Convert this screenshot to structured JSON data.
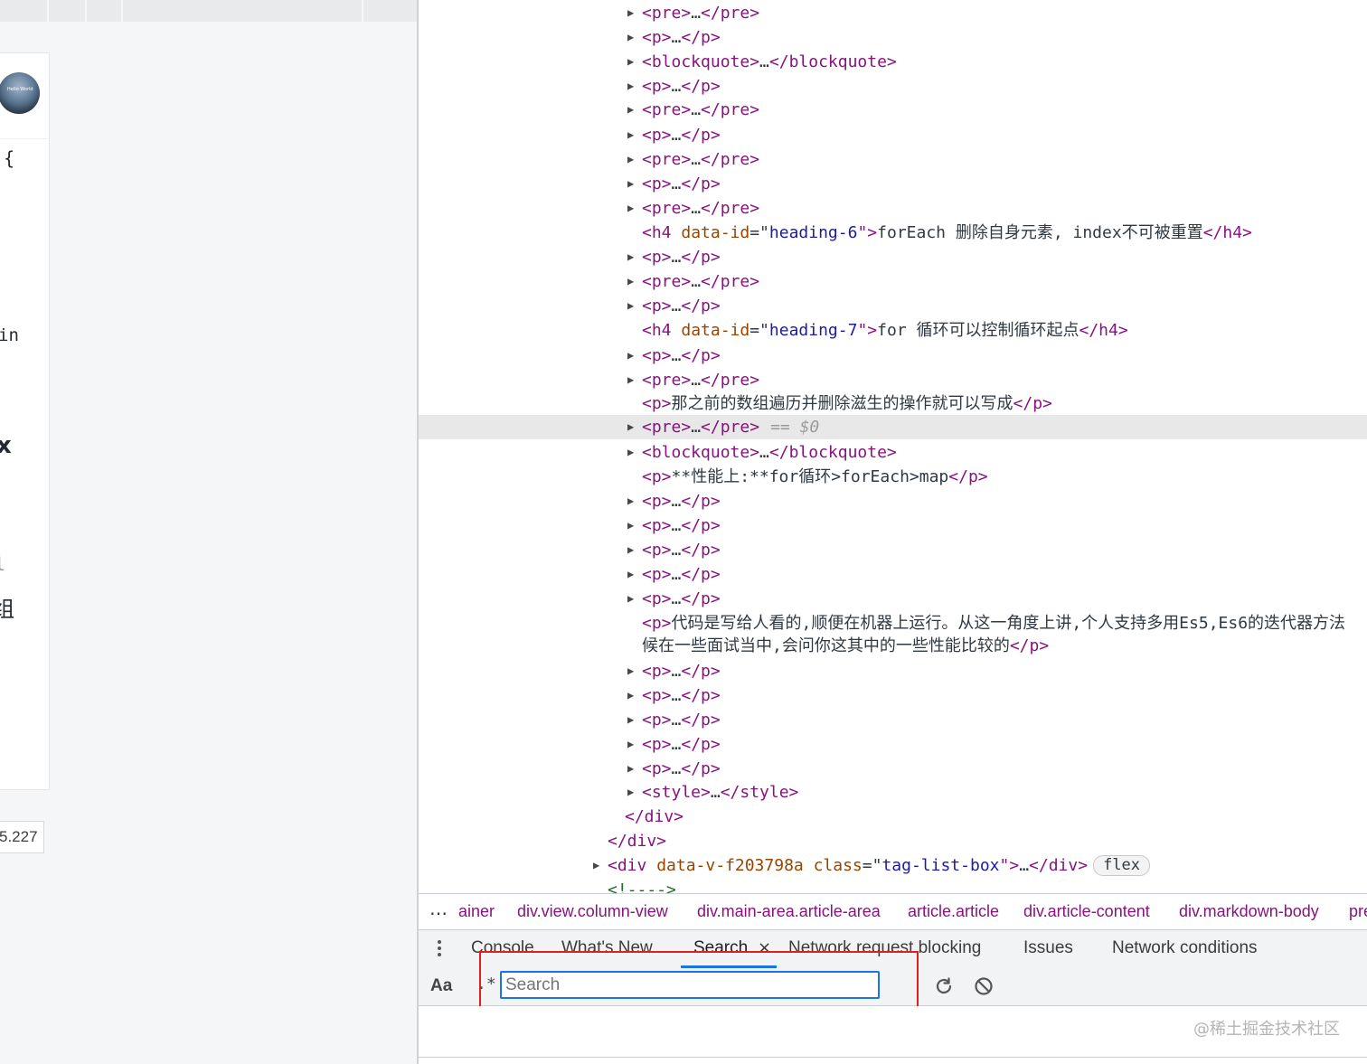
{
  "left_page": {
    "avatar_text": "Hello World",
    "fragments": [
      "{",
      "in",
      "x",
      "l",
      "组"
    ],
    "version_text": "5.227"
  },
  "dom_rows": [
    {
      "open": "<pre>",
      "ellipsis": "…",
      "close": "</pre>"
    },
    {
      "open": "<p>",
      "ellipsis": "…",
      "close": "</p>"
    },
    {
      "open": "<blockquote>",
      "ellipsis": "…",
      "close": "</blockquote>"
    },
    {
      "open": "<p>",
      "ellipsis": "…",
      "close": "</p>"
    },
    {
      "open": "<pre>",
      "ellipsis": "…",
      "close": "</pre>"
    },
    {
      "open": "<p>",
      "ellipsis": "…",
      "close": "</p>"
    },
    {
      "open": "<pre>",
      "ellipsis": "…",
      "close": "</pre>"
    },
    {
      "open": "<p>",
      "ellipsis": "…",
      "close": "</p>"
    },
    {
      "open": "<pre>",
      "ellipsis": "…",
      "close": "</pre>"
    },
    {
      "open_start": "<h4 ",
      "attr_name": "data-id",
      "eq": "=\"",
      "attr_value": "heading-6",
      "quote_gt": "\">",
      "text": "forEach 删除自身元素, index不可被重置",
      "close": "</h4>"
    },
    {
      "open": "<p>",
      "ellipsis": "…",
      "close": "</p>"
    },
    {
      "open": "<pre>",
      "ellipsis": "…",
      "close": "</pre>"
    },
    {
      "open": "<p>",
      "ellipsis": "…",
      "close": "</p>"
    },
    {
      "open_start": "<h4 ",
      "attr_name": "data-id",
      "eq": "=\"",
      "attr_value": "heading-7",
      "quote_gt": "\">",
      "text": "for 循环可以控制循环起点",
      "close": "</h4>"
    },
    {
      "open": "<p>",
      "ellipsis": "…",
      "close": "</p>"
    },
    {
      "open": "<pre>",
      "ellipsis": "…",
      "close": "</pre>"
    },
    {
      "open": "<p>",
      "text": "那之前的数组遍历并删除滋生的操作就可以写成",
      "close": "</p>"
    },
    {
      "open": "<pre>",
      "ellipsis": "…",
      "close": "</pre>",
      "marker": "== $0"
    },
    {
      "open": "<blockquote>",
      "ellipsis": "…",
      "close": "</blockquote>"
    },
    {
      "open": "<p>",
      "text": "**性能上:**for循环>forEach>map",
      "close": "</p>"
    },
    {
      "open": "<p>",
      "ellipsis": "…",
      "close": "</p>"
    },
    {
      "open": "<p>",
      "ellipsis": "…",
      "close": "</p>"
    },
    {
      "open": "<p>",
      "ellipsis": "…",
      "close": "</p>"
    },
    {
      "open": "<p>",
      "ellipsis": "…",
      "close": "</p>"
    },
    {
      "open": "<p>",
      "ellipsis": "…",
      "close": "</p>"
    },
    {
      "open": "<p>",
      "text": "代码是写给人看的,顺便在机器上运行。从这一角度上讲,个人支持多用Es5,Es6的迭代器方法",
      "close": ""
    },
    {
      "text": "候在一些面试当中,会问你这其中的一些性能比较的",
      "close": "</p>"
    },
    {
      "open": "<p>",
      "ellipsis": "…",
      "close": "</p>"
    },
    {
      "open": "<p>",
      "ellipsis": "…",
      "close": "</p>"
    },
    {
      "open": "<p>",
      "ellipsis": "…",
      "close": "</p>"
    },
    {
      "open": "<p>",
      "ellipsis": "…",
      "close": "</p>"
    },
    {
      "open": "<p>",
      "ellipsis": "…",
      "close": "</p>"
    },
    {
      "open": "<style>",
      "ellipsis": "…",
      "close": "</style>"
    },
    {
      "close": "</div>"
    },
    {
      "close": "</div>"
    },
    {
      "open_start": "<div ",
      "attr_name": "data-v-f203798a class",
      "eq": "=\"",
      "attr_value": "tag-list-box",
      "quote_gt": "\">",
      "ellipsis": "…",
      "close": "</div>",
      "badge": "flex"
    },
    {
      "comment": "<!---->"
    }
  ],
  "breadcrumb": {
    "more": "…",
    "items": [
      "ainer",
      "div.view.column-view",
      "div.main-area.article-area",
      "article.article",
      "div.article-content",
      "div.markdown-body",
      "pre"
    ]
  },
  "drawer": {
    "tabs": [
      "Console",
      "What's New",
      "Search",
      "Network request blocking",
      "Issues",
      "Network conditions"
    ],
    "active_tab": "Search",
    "close_glyph": "×"
  },
  "search": {
    "match_case_label": "Aa",
    "regex_label": ".*",
    "placeholder": "Search",
    "value": ""
  },
  "watermark": "@稀土掘金技术社区",
  "icons": {
    "refresh": "refresh-icon",
    "clear": "clear-icon",
    "expand": "expand-triangle-icon",
    "more": "more-icon"
  },
  "colors": {
    "tag": "#881280",
    "attr": "#994500",
    "value": "#1a1aa6",
    "accent": "#1a73e8",
    "annotation": "#e02020"
  }
}
